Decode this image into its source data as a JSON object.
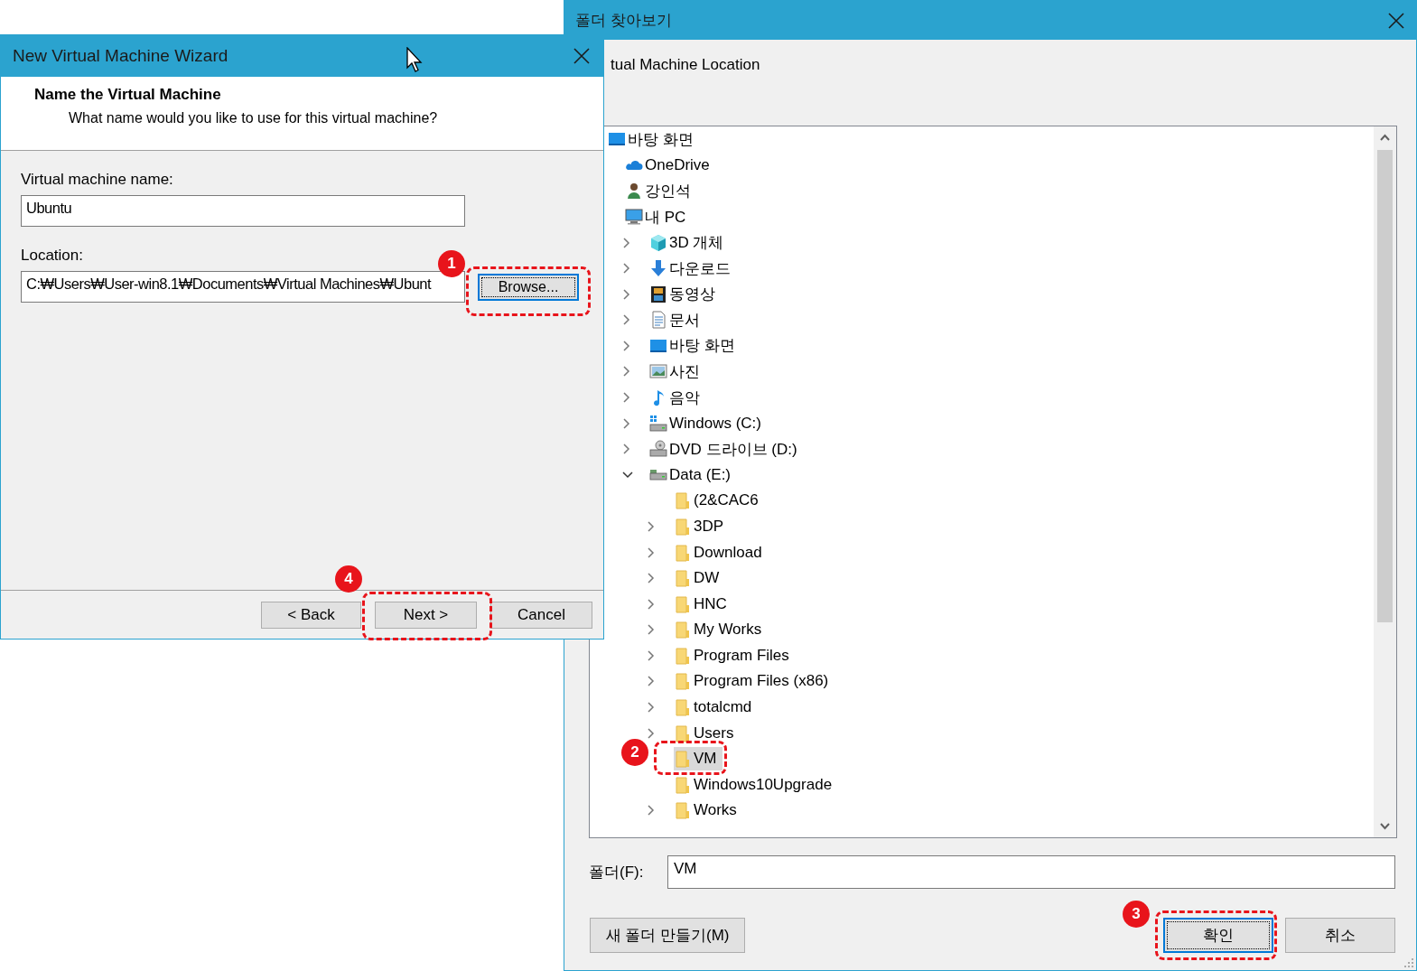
{
  "browse_dialog": {
    "title": "폴더 찾아보기",
    "description": "tual Machine Location",
    "tree": [
      {
        "label": "바탕 화면",
        "kind": "desktop",
        "selected": false,
        "children": [
          {
            "label": "OneDrive",
            "kind": "cloud",
            "selected": false
          },
          {
            "label": "강인석",
            "kind": "user",
            "selected": false
          },
          {
            "label": "내 PC",
            "kind": "pc",
            "selected": false,
            "children": [
              {
                "label": "3D 개체",
                "kind": "cube",
                "expanded": false,
                "selected": false
              },
              {
                "label": "다운로드",
                "kind": "download",
                "expanded": false,
                "selected": false
              },
              {
                "label": "동영상",
                "kind": "video",
                "expanded": false,
                "selected": false
              },
              {
                "label": "문서",
                "kind": "document",
                "expanded": false,
                "selected": false
              },
              {
                "label": "바탕 화면",
                "kind": "desktop",
                "expanded": false,
                "selected": false
              },
              {
                "label": "사진",
                "kind": "pictures",
                "expanded": false,
                "selected": false
              },
              {
                "label": "음악",
                "kind": "music",
                "expanded": false,
                "selected": false
              },
              {
                "label": "Windows (C:)",
                "kind": "drive-windows",
                "expanded": false,
                "selected": false
              },
              {
                "label": "DVD 드라이브 (D:)",
                "kind": "dvd",
                "expanded": false,
                "selected": false
              },
              {
                "label": "Data (E:)",
                "kind": "drive",
                "expanded": true,
                "selected": false,
                "children": [
                  {
                    "label": "(2&CAC6",
                    "kind": "folder",
                    "selected": false
                  },
                  {
                    "label": "3DP",
                    "kind": "folder",
                    "expanded": false,
                    "selected": false
                  },
                  {
                    "label": "Download",
                    "kind": "folder",
                    "expanded": false,
                    "selected": false
                  },
                  {
                    "label": "DW",
                    "kind": "folder",
                    "expanded": false,
                    "selected": false
                  },
                  {
                    "label": "HNC",
                    "kind": "folder",
                    "expanded": false,
                    "selected": false
                  },
                  {
                    "label": "My Works",
                    "kind": "folder",
                    "expanded": false,
                    "selected": false
                  },
                  {
                    "label": "Program Files",
                    "kind": "folder",
                    "expanded": false,
                    "selected": false
                  },
                  {
                    "label": "Program Files (x86)",
                    "kind": "folder",
                    "expanded": false,
                    "selected": false
                  },
                  {
                    "label": "totalcmd",
                    "kind": "folder",
                    "expanded": false,
                    "selected": false
                  },
                  {
                    "label": "Users",
                    "kind": "folder",
                    "expanded": false,
                    "selected": false
                  },
                  {
                    "label": "VM",
                    "kind": "folder",
                    "selected": true
                  },
                  {
                    "label": "Windows10Upgrade",
                    "kind": "folder",
                    "selected": false
                  },
                  {
                    "label": "Works",
                    "kind": "folder",
                    "expanded": false,
                    "selected": false
                  }
                ]
              }
            ]
          }
        ]
      }
    ],
    "folder_label": "폴더(F):",
    "folder_value": "VM",
    "buttons": [
      {
        "label": "새 폴더 만들기(M)",
        "focused": false
      },
      {
        "label": "확인",
        "focused": true
      },
      {
        "label": "취소",
        "focused": false
      }
    ]
  },
  "wizard": {
    "title": "New Virtual Machine Wizard",
    "heading": "Name the Virtual Machine",
    "subheading": "What name would you like to use for this virtual machine?",
    "fields": [
      {
        "label": "Virtual machine name:",
        "value": "Ubuntu"
      },
      {
        "label": "Location:",
        "value": "C:₩Users₩User-win8.1₩Documents₩Virtual Machines₩Ubunt"
      }
    ],
    "browse_button": {
      "label": "Browse...",
      "focused": true
    },
    "buttons": [
      {
        "label": "< Back",
        "focused": false
      },
      {
        "label": "Next >",
        "focused": false
      },
      {
        "label": "Cancel",
        "focused": false
      }
    ]
  },
  "annotations": [
    {
      "number": "1"
    },
    {
      "number": "2"
    },
    {
      "number": "3"
    },
    {
      "number": "4"
    }
  ]
}
